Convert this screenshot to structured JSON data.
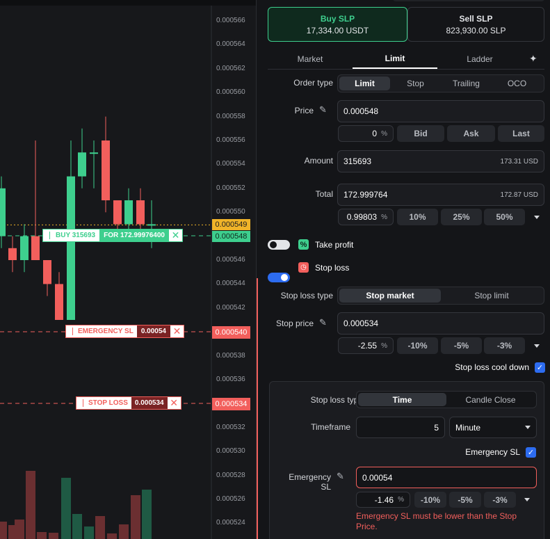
{
  "chart": {
    "price_ticks": [
      "0.000566",
      "0.000564",
      "0.000562",
      "0.000560",
      "0.000558",
      "0.000556",
      "0.000554",
      "0.000552",
      "0.000550",
      "0.000546",
      "0.000544",
      "0.000542",
      "0.000538",
      "0.000536",
      "0.000532",
      "0.000530",
      "0.000528",
      "0.000526",
      "0.000524"
    ],
    "current_price": "0.000549",
    "buy_price_tag": "0.000548",
    "emergency_price_tag": "0.000540",
    "stoploss_price_tag": "0.000534",
    "buy_order": {
      "label": "BUY 315693",
      "for": "FOR 172.99976400"
    },
    "emergency_order": {
      "label": "EMERGENCY SL",
      "value": "0.00054"
    },
    "stoploss_order": {
      "label": "STOP LOSS",
      "value": "0.000534"
    },
    "colors": {
      "up": "#3ecf8e",
      "down": "#f25f5c"
    }
  },
  "side": {
    "buy": {
      "title": "Buy SLP",
      "sub": "17,334.00 USDT"
    },
    "sell": {
      "title": "Sell SLP",
      "sub": "823,930.00 SLP"
    }
  },
  "main_tabs": [
    "Market",
    "Limit",
    "Ladder"
  ],
  "order_type": {
    "label": "Order type",
    "options": [
      "Limit",
      "Stop",
      "Trailing",
      "OCO"
    ]
  },
  "price": {
    "label": "Price",
    "value": "0.000548",
    "pct": "0",
    "buttons": [
      "Bid",
      "Ask",
      "Last"
    ]
  },
  "amount": {
    "label": "Amount",
    "value": "315693",
    "usd": "173.31 USD"
  },
  "total": {
    "label": "Total",
    "value": "172.999764",
    "usd": "172.87 USD",
    "pct": "0.99803",
    "buttons": [
      "10%",
      "25%",
      "50%"
    ]
  },
  "take_profit": {
    "label": "Take profit"
  },
  "stop_loss": {
    "label": "Stop loss"
  },
  "sl_type": {
    "label": "Stop loss type",
    "options": [
      "Stop market",
      "Stop limit"
    ]
  },
  "stop_price": {
    "label": "Stop price",
    "value": "0.000534",
    "pct": "-2.55",
    "buttons": [
      "-10%",
      "-5%",
      "-3%"
    ]
  },
  "cooldown": {
    "label": "Stop loss cool down"
  },
  "sl_type2": {
    "label": "Stop loss type",
    "options": [
      "Time",
      "Candle Close"
    ]
  },
  "timeframe": {
    "label": "Timeframe",
    "value": "5",
    "unit": "Minute"
  },
  "emergency_toggle": {
    "label": "Emergency SL"
  },
  "emergency": {
    "label": "Emergency SL",
    "value": "0.00054",
    "pct": "-1.46",
    "buttons": [
      "-10%",
      "-5%",
      "-3%"
    ],
    "error": "Emergency SL must be lower than the Stop Price."
  }
}
